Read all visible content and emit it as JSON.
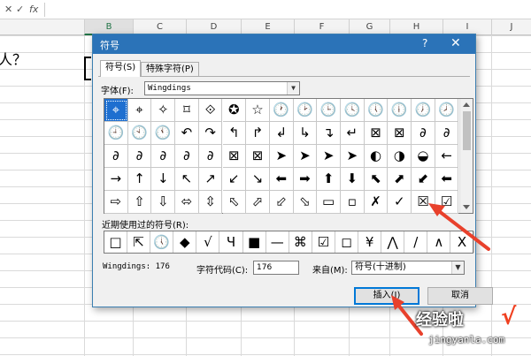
{
  "excel": {
    "formula_icons": [
      "✕",
      "✓",
      "fx"
    ],
    "columns": [
      "B",
      "C",
      "D",
      "E",
      "F",
      "G",
      "H",
      "I",
      "J"
    ],
    "cell_text": "人？"
  },
  "dialog": {
    "title": "符号",
    "help": "?",
    "close": "✕",
    "tabs": [
      "符号(S)",
      "特殊字符(P)"
    ],
    "font_label": "字体(F):",
    "font_value": "Wingdings",
    "symbols": [
      [
        "⌖",
        "⌖",
        "✧",
        "⌑",
        "⟐",
        "✪",
        "☆",
        "🕐",
        "🕑",
        "🕒",
        "🕓",
        "🕔",
        "🕕",
        "🕖",
        "🕗"
      ],
      [
        "🕘",
        "🕙",
        "🕚",
        "↶",
        "↷",
        "↰",
        "↱",
        "↲",
        "↳",
        "↴",
        "↵",
        "⊠",
        "⊠",
        "∂",
        "∂"
      ],
      [
        "∂",
        "∂",
        "∂",
        "∂",
        "∂",
        "⊠",
        "⊠",
        "➤",
        "➤",
        "➤",
        "➤",
        "◐",
        "◑",
        "◒",
        "←"
      ],
      [
        "→",
        "↑",
        "↓",
        "↖",
        "↗",
        "↙",
        "↘",
        "⬅",
        "➡",
        "⬆",
        "⬇",
        "⬉",
        "⬈",
        "⬋",
        "⬅"
      ],
      [
        "⇨",
        "⇧",
        "⇩",
        "⬄",
        "⇳",
        "⬁",
        "⬀",
        "⬃",
        "⬂",
        "▭",
        "▫",
        "✗",
        "✓",
        "☒",
        "☑"
      ]
    ],
    "recent_label": "近期使用过的符号(R):",
    "recent": [
      "□",
      "⇱",
      "🕔",
      "◆",
      "√",
      "Ч",
      "■",
      "—",
      "⌘",
      "☑",
      "◻",
      "¥",
      "⋀",
      "/",
      "∧",
      "X"
    ],
    "font_info": "Wingdings: 176",
    "code_label": "字符代码(C):",
    "code_value": "176",
    "from_label": "来自(M):",
    "from_value": "符号(十进制)",
    "insert": "插入(I)",
    "cancel": "取消"
  },
  "watermark": {
    "line1": "经验啦",
    "check": "√",
    "line2": "jingyanla.com"
  }
}
